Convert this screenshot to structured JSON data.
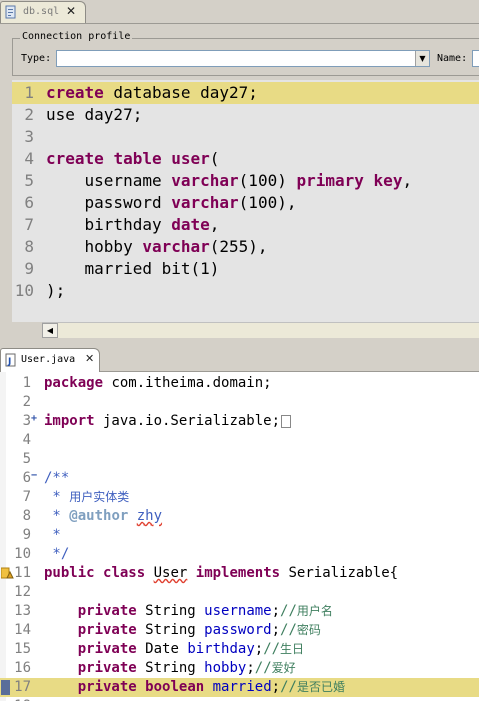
{
  "sql_editor": {
    "tab": {
      "label": "db.sql",
      "close_label": "✕"
    },
    "profile": {
      "legend": "Connection profile",
      "type_label": "Type:",
      "type_value": "",
      "name_label": "Name:",
      "name_value": ""
    },
    "highlight_color": "#e8db85",
    "lines": [
      {
        "num": "1",
        "segs": [
          {
            "t": "create",
            "c": "kw"
          },
          {
            "t": " database day27;"
          }
        ]
      },
      {
        "num": "2",
        "segs": [
          {
            "t": "use day27;"
          }
        ]
      },
      {
        "num": "3",
        "segs": []
      },
      {
        "num": "4",
        "segs": [
          {
            "t": "create",
            "c": "kw"
          },
          {
            "t": " "
          },
          {
            "t": "table",
            "c": "kw"
          },
          {
            "t": " "
          },
          {
            "t": "user",
            "c": "kw"
          },
          {
            "t": "("
          }
        ]
      },
      {
        "num": "5",
        "segs": [
          {
            "t": "    username "
          },
          {
            "t": "varchar",
            "c": "kw"
          },
          {
            "t": "(100) "
          },
          {
            "t": "primary",
            "c": "kw"
          },
          {
            "t": " "
          },
          {
            "t": "key",
            "c": "kw"
          },
          {
            "t": ","
          }
        ]
      },
      {
        "num": "6",
        "segs": [
          {
            "t": "    password "
          },
          {
            "t": "varchar",
            "c": "kw"
          },
          {
            "t": "(100),"
          }
        ]
      },
      {
        "num": "7",
        "segs": [
          {
            "t": "    birthday "
          },
          {
            "t": "date",
            "c": "kw"
          },
          {
            "t": ","
          }
        ]
      },
      {
        "num": "8",
        "segs": [
          {
            "t": "    hobby "
          },
          {
            "t": "varchar",
            "c": "kw"
          },
          {
            "t": "(255),"
          }
        ]
      },
      {
        "num": "9",
        "segs": [
          {
            "t": "    married bit(1)"
          }
        ]
      },
      {
        "num": "10",
        "segs": [
          {
            "t": ");"
          }
        ]
      }
    ]
  },
  "java_editor": {
    "tab": {
      "label": "User.java",
      "close_label": "✕"
    },
    "lines": [
      {
        "num": "1",
        "segs": [
          {
            "t": "package",
            "c": "kw"
          },
          {
            "t": " com.itheima.domain;"
          }
        ]
      },
      {
        "num": "2",
        "segs": []
      },
      {
        "num": "3",
        "fold": "+",
        "collapsed": true,
        "segs": [
          {
            "t": "import",
            "c": "kw"
          },
          {
            "t": " java.io.Serializable;"
          }
        ]
      },
      {
        "num": "4",
        "segs": []
      },
      {
        "num": "5",
        "segs": []
      },
      {
        "num": "6",
        "fold": "−",
        "segs": [
          {
            "t": "/**",
            "c": "jdoc"
          }
        ]
      },
      {
        "num": "7",
        "segs": [
          {
            "t": " * ",
            "c": "jdoc"
          },
          {
            "t": "用户实体类",
            "c": "jdoc cjk"
          }
        ]
      },
      {
        "num": "8",
        "segs": [
          {
            "t": " * ",
            "c": "jdoc"
          },
          {
            "t": "@author",
            "c": "jtag"
          },
          {
            "t": " "
          },
          {
            "t": "zhy",
            "c": "jdoc squig"
          }
        ]
      },
      {
        "num": "9",
        "segs": [
          {
            "t": " *",
            "c": "jdoc"
          }
        ]
      },
      {
        "num": "10",
        "segs": [
          {
            "t": " */",
            "c": "jdoc"
          }
        ]
      },
      {
        "num": "11",
        "marker": "bookmark",
        "segs": [
          {
            "t": "public",
            "c": "kw"
          },
          {
            "t": " "
          },
          {
            "t": "class",
            "c": "kw"
          },
          {
            "t": " "
          },
          {
            "t": "User",
            "c": "squig"
          },
          {
            "t": " "
          },
          {
            "t": "implements",
            "c": "kw"
          },
          {
            "t": " Serializable{"
          }
        ]
      },
      {
        "num": "12",
        "segs": []
      },
      {
        "num": "13",
        "segs": [
          {
            "t": "    "
          },
          {
            "t": "private",
            "c": "kw"
          },
          {
            "t": " String "
          },
          {
            "t": "username",
            "c": "fld"
          },
          {
            "t": ";"
          },
          {
            "t": "//",
            "c": "cmt"
          },
          {
            "t": "用户名",
            "c": "cmt cjk"
          }
        ]
      },
      {
        "num": "14",
        "segs": [
          {
            "t": "    "
          },
          {
            "t": "private",
            "c": "kw"
          },
          {
            "t": " String "
          },
          {
            "t": "password",
            "c": "fld"
          },
          {
            "t": ";"
          },
          {
            "t": "//",
            "c": "cmt"
          },
          {
            "t": "密码",
            "c": "cmt cjk"
          }
        ]
      },
      {
        "num": "15",
        "segs": [
          {
            "t": "    "
          },
          {
            "t": "private",
            "c": "kw"
          },
          {
            "t": " Date "
          },
          {
            "t": "birthday",
            "c": "fld"
          },
          {
            "t": ";"
          },
          {
            "t": "//",
            "c": "cmt"
          },
          {
            "t": "生日",
            "c": "cmt cjk"
          }
        ]
      },
      {
        "num": "16",
        "segs": [
          {
            "t": "    "
          },
          {
            "t": "private",
            "c": "kw"
          },
          {
            "t": " String "
          },
          {
            "t": "hobby",
            "c": "fld"
          },
          {
            "t": ";"
          },
          {
            "t": "//",
            "c": "cmt"
          },
          {
            "t": "爱好",
            "c": "cmt cjk"
          }
        ]
      },
      {
        "num": "17",
        "marker": "blue",
        "segs": [
          {
            "t": "    "
          },
          {
            "t": "private",
            "c": "kw"
          },
          {
            "t": " "
          },
          {
            "t": "boolean",
            "c": "kw"
          },
          {
            "t": " "
          },
          {
            "t": "married",
            "c": "fld"
          },
          {
            "t": ";"
          },
          {
            "t": "//",
            "c": "cmt"
          },
          {
            "t": "是否已婚",
            "c": "cmt cjk"
          }
        ]
      },
      {
        "num": "18",
        "segs": []
      }
    ]
  }
}
